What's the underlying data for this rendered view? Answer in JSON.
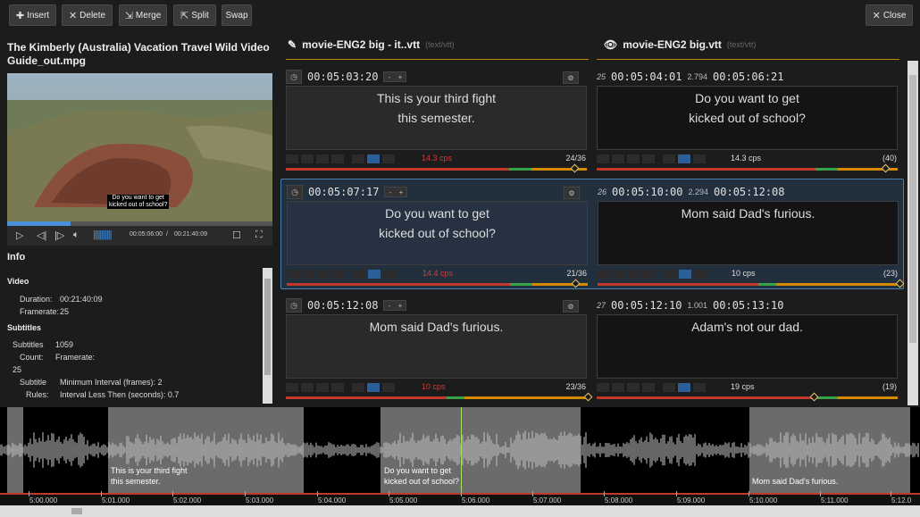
{
  "toolbar": {
    "insert": "Insert",
    "delete": "Delete",
    "merge": "Merge",
    "split": "Split",
    "swap": "Swap",
    "close": "Close"
  },
  "video": {
    "title": "The Kimberly (Australia) Vacation Travel Wild Video Guide_out.mpg",
    "subtitle": "Do you want to get\nkicked out of school?",
    "current_time": "00:05:06:00",
    "separator": "/",
    "total_time": "00:21:40:09",
    "progress": 0.24
  },
  "info": {
    "heading": "Info",
    "video_section": "Video",
    "duration_label": "Duration:",
    "duration": "00:21:40:09",
    "framerate_label": "Framerate:",
    "framerate": "25",
    "subtitles_section": "Subtitles",
    "count_label_1": "Subtitles",
    "count_label_2": "Count:",
    "count": "1059",
    "fr_label": "Framerate:",
    "fr": "25",
    "rules_label_1": "Subtitle",
    "rules_label_2": "Rules:",
    "rule1": "Minimum Interval (frames): 2",
    "rule2": "Interval Less Then (seconds): 0.7"
  },
  "columns": {
    "left_name": "movie-ENG2 big - it..vtt",
    "left_type": "(text/vtt)",
    "right_name": "movie-ENG2 big.vtt",
    "right_type": "(text/vtt)"
  },
  "rows": [
    {
      "left": {
        "time": "00:05:03:20",
        "text": "This is your third fight\nthis semester.",
        "cps": "14.3 cps",
        "count": "24/36"
      },
      "right": {
        "index": "25",
        "start": "00:05:04:01",
        "dur": "2.794",
        "end": "00:05:06:21",
        "text": "Do you want to get\nkicked out of school?",
        "cps": "14.3 cps",
        "count": "(40)"
      }
    },
    {
      "left": {
        "time": "00:05:07:17",
        "text": "Do you want to get\nkicked out of school?",
        "cps": "14.4 cps",
        "count": "21/36"
      },
      "right": {
        "index": "26",
        "start": "00:05:10:00",
        "dur": "2.294",
        "end": "00:05:12:08",
        "text": "Mom said Dad's furious.",
        "cps": "10 cps",
        "count": "(23)"
      }
    },
    {
      "left": {
        "time": "00:05:12:08",
        "text": "Mom said Dad's furious.",
        "cps": "10 cps",
        "count": "23/36"
      },
      "right": {
        "index": "27",
        "start": "00:05:12:10",
        "dur": "1.001",
        "end": "00:05:13:10",
        "text": "Adam's not our dad.",
        "cps": "19 cps",
        "count": "(19)"
      }
    }
  ],
  "waveform": {
    "segments": [
      {
        "text": "This is your third fight\nthis semester."
      },
      {
        "text": "Do you want to get\nkicked out of school?"
      },
      {
        "text": "Mom said Dad's furious."
      }
    ],
    "ticks": [
      "5:00.000",
      "5:01.000",
      "5:02.000",
      "5:03.000",
      "5:04.000",
      "5:05.000",
      "5:06.000",
      "5:07.000",
      "5:08.000",
      "5:09.000",
      "5:10.000",
      "5:11.000",
      "5:12.0"
    ]
  },
  "colors": {
    "accent": "#4a90d9",
    "warn": "#c0392b",
    "ok": "#37a34a",
    "bar": "#d68a00"
  }
}
